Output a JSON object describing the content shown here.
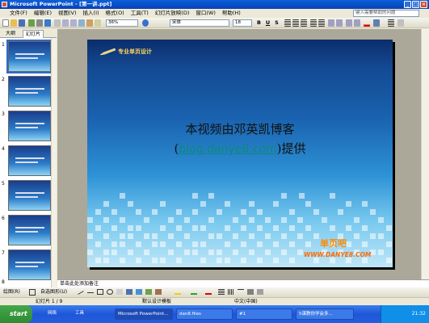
{
  "window": {
    "title": "Microsoft PowerPoint - [第一讲.ppt]"
  },
  "menus": [
    "文件(F)",
    "编辑(E)",
    "视图(V)",
    "插入(I)",
    "格式(O)",
    "工具(T)",
    "幻灯片放映(D)",
    "窗口(W)",
    "帮助(H)"
  ],
  "help": {
    "placeholder": "键入需要帮助的问题"
  },
  "toolbar": {
    "zoom": "36%",
    "font": "宋体",
    "size": "18",
    "bold": "B",
    "underline": "U",
    "shadow": "S"
  },
  "left_pane": {
    "tabs": [
      "大纲",
      "幻灯片"
    ],
    "slides": [
      "1",
      "2",
      "3",
      "4",
      "5",
      "6",
      "7",
      "8"
    ]
  },
  "slide": {
    "tag": "专业单页设计",
    "line1": "本视频由邓英凯博客",
    "line2_open": "(",
    "line2_url": "blog.danye8.com",
    "line2_close": ")提供",
    "logo_cn": "单页吧",
    "logo_url": "WWW.DANYE8.COM"
  },
  "notes": {
    "placeholder": "单击此处添加备注"
  },
  "drawbar": {
    "draw": "绘图(R)",
    "autoshapes": "自选图形(U)"
  },
  "status": {
    "slide": "幻灯片 1 / 9",
    "template": "默认设计模板",
    "language": "中文(中国)"
  },
  "taskbar": {
    "start": "start",
    "items": [
      "网络",
      "工具",
      "Microsoft PowerPoint...",
      "dan8.files",
      "#1",
      "5课教你学会多..."
    ],
    "time": "21:32"
  }
}
